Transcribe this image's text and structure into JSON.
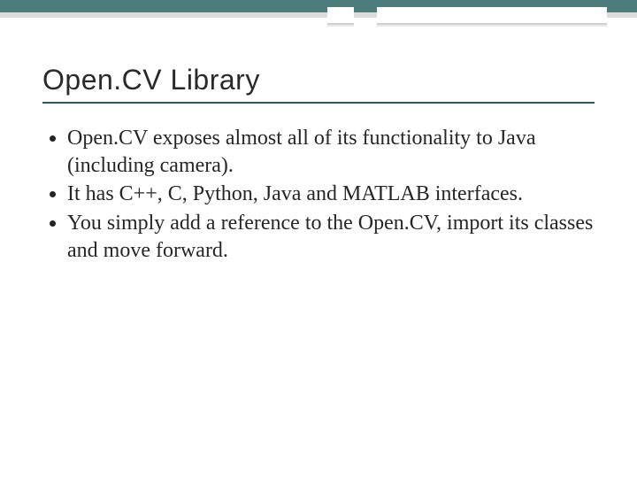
{
  "slide": {
    "title": "Open.CV Library",
    "bullets": [
      "Open.CV exposes almost all of its functionality to Java (including camera).",
      "It has C++, C, Python, Java and MATLAB interfaces.",
      " You simply add a reference to the Open.CV, import its classes and move forward."
    ]
  },
  "theme": {
    "accent_color": "#4d7c7c",
    "rule_color": "#2f5a5a"
  }
}
